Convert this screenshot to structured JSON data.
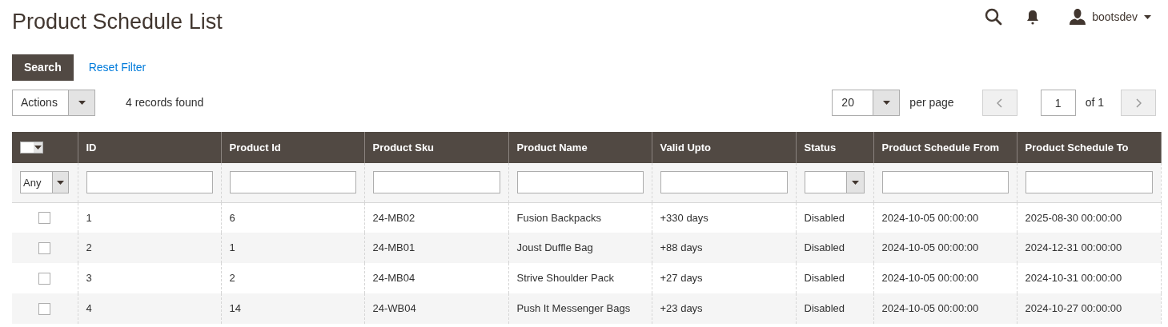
{
  "page_title": "Product Schedule List",
  "header": {
    "user": "bootsdev"
  },
  "filter_bar": {
    "search_button": "Search",
    "reset_link": "Reset Filter"
  },
  "toolbar": {
    "actions": "Actions",
    "records": "4 records found",
    "page_size": "20",
    "per_page_label": "per page",
    "page": "1",
    "of_label": "of 1"
  },
  "table": {
    "columns": [
      {
        "label": "ID",
        "filter": {
          "kind": "text"
        }
      },
      {
        "label": "Product Id",
        "filter": {
          "kind": "text"
        }
      },
      {
        "label": "Product Sku",
        "filter": {
          "kind": "text"
        }
      },
      {
        "label": "Product Name",
        "filter": {
          "kind": "text"
        }
      },
      {
        "label": "Valid Upto",
        "filter": {
          "kind": "text"
        }
      },
      {
        "label": "Status",
        "filter": {
          "kind": "select"
        }
      },
      {
        "label": "Product Schedule From",
        "filter": {
          "kind": "text"
        }
      },
      {
        "label": "Product Schedule To",
        "filter": {
          "kind": "text"
        }
      }
    ],
    "select_filter": "Any",
    "rows": [
      {
        "checked": false,
        "cells": [
          "1",
          "6",
          "24-MB02",
          "Fusion Backpacks",
          "+330 days",
          "Disabled",
          "2024-10-05 00:00:00",
          "2025-08-30 00:00:00"
        ]
      },
      {
        "checked": false,
        "cells": [
          "2",
          "1",
          "24-MB01",
          "Joust Duffle Bag",
          "+88 days",
          "Disabled",
          "2024-10-05 00:00:00",
          "2024-12-31 00:00:00"
        ]
      },
      {
        "checked": false,
        "cells": [
          "3",
          "2",
          "24-MB04",
          "Strive Shoulder Pack",
          "+27 days",
          "Disabled",
          "2024-10-05 00:00:00",
          "2024-10-31 00:00:00"
        ]
      },
      {
        "checked": false,
        "cells": [
          "4",
          "14",
          "24-WB04",
          "Push It Messenger Bags",
          "+23 days",
          "Disabled",
          "2024-10-05 00:00:00",
          "2024-10-27 00:00:00"
        ]
      }
    ]
  }
}
